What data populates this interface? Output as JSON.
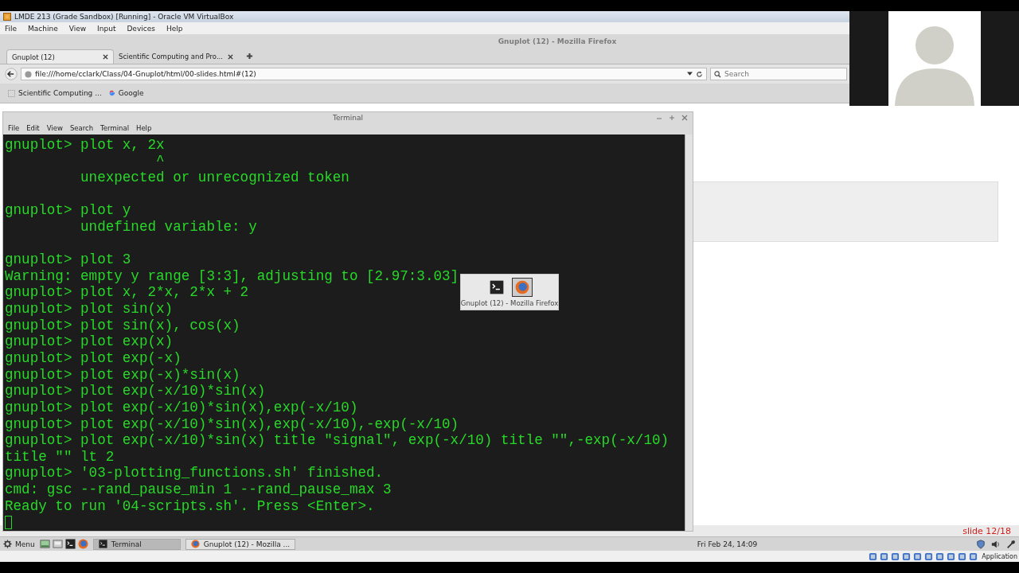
{
  "vbox": {
    "title": "LMDE 213 (Grade Sandbox) [Running] - Oracle VM VirtualBox",
    "menu": [
      "File",
      "Machine",
      "View",
      "Input",
      "Devices",
      "Help"
    ],
    "status_text": "Application"
  },
  "firefox": {
    "title": "Gnuplot (12) - Mozilla Firefox",
    "tabs": [
      {
        "label": "Gnuplot (12)",
        "selected": true
      },
      {
        "label": "Scientific Computing and Pro...",
        "selected": false
      }
    ],
    "url": "file:///home/cclark/Class/04-Gnuplot/html/00-slides.html#(12)",
    "search_placeholder": "Search",
    "bookmarks": [
      {
        "kind": "page",
        "label": "Scientific Computing ..."
      },
      {
        "kind": "google",
        "label": "Google"
      }
    ],
    "slide_counter": "slide 12/18"
  },
  "terminal": {
    "title": "Terminal",
    "menu": [
      "File",
      "Edit",
      "View",
      "Search",
      "Terminal",
      "Help"
    ],
    "blocks": [
      [
        "gnuplot> plot x, 2x",
        "                  ^",
        "         unexpected or unrecognized token"
      ],
      [
        "gnuplot> plot y",
        "         undefined variable: y"
      ],
      [
        "gnuplot> plot 3",
        "Warning: empty y range [3:3], adjusting to [2.97:3.03]",
        "gnuplot> plot x, 2*x, 2*x + 2",
        "gnuplot> plot sin(x)",
        "gnuplot> plot sin(x), cos(x)",
        "gnuplot> plot exp(x)",
        "gnuplot> plot exp(-x)",
        "gnuplot> plot exp(-x)*sin(x)",
        "gnuplot> plot exp(-x/10)*sin(x)",
        "gnuplot> plot exp(-x/10)*sin(x),exp(-x/10)",
        "gnuplot> plot exp(-x/10)*sin(x),exp(-x/10),-exp(-x/10)",
        "gnuplot> plot exp(-x/10)*sin(x) title \"signal\", exp(-x/10) title \"\",-exp(-x/10)",
        "title \"\" lt 2",
        "gnuplot> '03-plotting_functions.sh' finished.",
        "cmd: gsc --rand_pause_min 1 --rand_pause_max 3",
        "Ready to run '04-scripts.sh'. Press <Enter>."
      ]
    ]
  },
  "switcher": {
    "items": [
      {
        "kind": "terminal",
        "selected": false
      },
      {
        "kind": "firefox",
        "selected": true
      }
    ],
    "label": "Gnuplot (12) - Mozilla Firefox"
  },
  "taskbar": {
    "menu_label": "Menu",
    "launchers": [
      {
        "kind": "desktop"
      },
      {
        "kind": "files"
      },
      {
        "kind": "terminal"
      },
      {
        "kind": "firefox"
      }
    ],
    "windows": [
      {
        "kind": "terminal",
        "label": "Terminal",
        "selected": true
      },
      {
        "kind": "firefox",
        "label": "Gnuplot (12) - Mozilla ...",
        "selected": false
      }
    ],
    "clock": "Fri Feb 24, 14:09"
  }
}
